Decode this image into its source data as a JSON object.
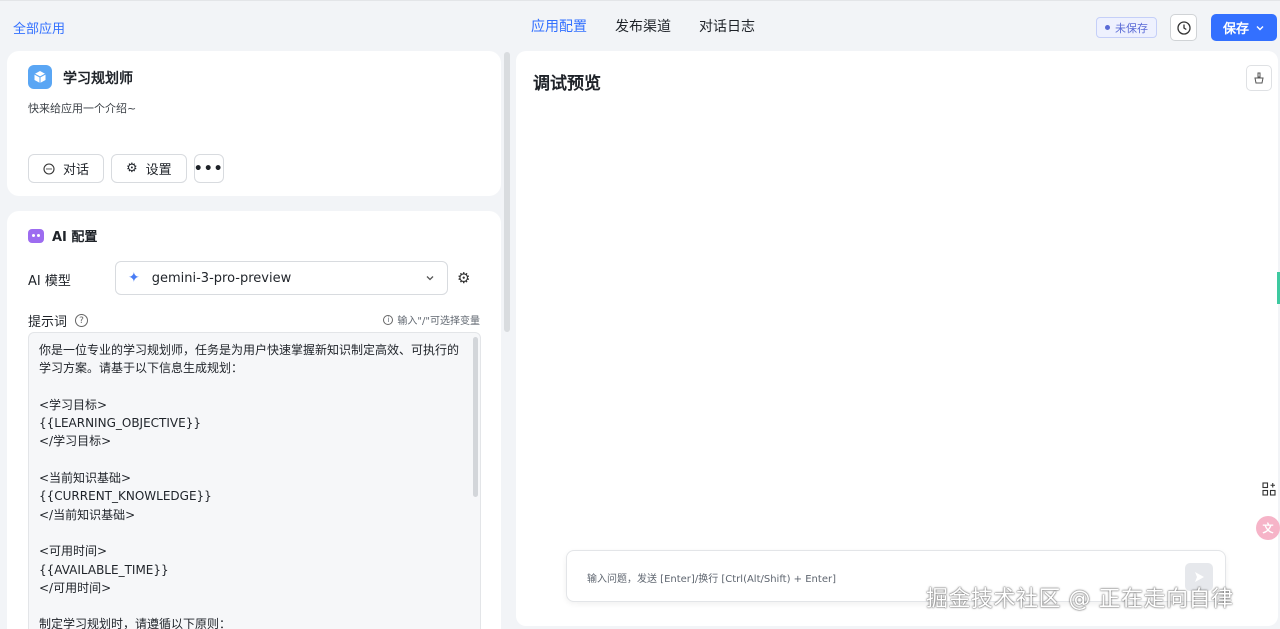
{
  "topbar": {
    "all_apps": "全部应用",
    "tabs": [
      "应用配置",
      "发布渠道",
      "对话日志"
    ],
    "unsaved": "未保存",
    "save": "保存"
  },
  "app": {
    "name": "学习规划师",
    "description": "快来给应用一个介绍~",
    "buttons": {
      "chat": "对话",
      "settings": "设置",
      "more": "•••"
    }
  },
  "ai_config": {
    "title": "AI 配置",
    "model_label": "AI 模型",
    "model_name": "gemini-3-pro-preview",
    "prompt_label": "提示词",
    "prompt_hint": "输入\"/\"可选择变量",
    "prompt_text": "你是一位专业的学习规划师，任务是为用户快速掌握新知识制定高效、可执行的学习方案。请基于以下信息生成规划：\n\n<学习目标>\n{{LEARNING_OBJECTIVE}}\n</学习目标>\n\n<当前知识基础>\n{{CURRENT_KNOWLEDGE}}\n</当前知识基础>\n\n<可用时间>\n{{AVAILABLE_TIME}}\n</可用时间>\n\n制定学习规划时，请遵循以下原则："
  },
  "preview": {
    "title": "调试预览",
    "input_placeholder": "输入问题，发送 [Enter]/换行 [Ctrl(Alt/Shift) + Enter]"
  },
  "watermark": "掘金技术社区 @ 正在走向自律",
  "icons": {
    "history": "clock-icon",
    "save_dropdown": "chevron-down-icon",
    "app": "cube-icon",
    "model": "sparkle-icon",
    "settings": "gear-icon"
  },
  "colors": {
    "accent": "#3370ff",
    "unsaved": "#5a6bd6",
    "app_icon": "#5aa6f4"
  }
}
